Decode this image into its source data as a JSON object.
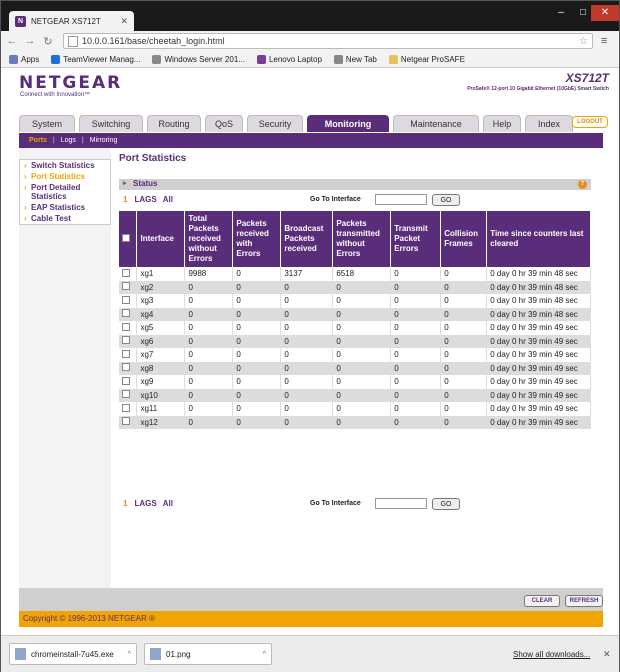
{
  "browser": {
    "tab_title": "NETGEAR XS712T",
    "favicon_letter": "N",
    "url": "10.0.0.161/base/cheetah_login.html",
    "bookmarks": [
      {
        "label": "Apps",
        "color": "#6b7bbf"
      },
      {
        "label": "TeamViewer Manag...",
        "color": "#1e6fd9"
      },
      {
        "label": "Windows Server 201...",
        "color": "#888888"
      },
      {
        "label": "Lenovo Laptop",
        "color": "#7a3b9a"
      },
      {
        "label": "New Tab",
        "color": "#888888"
      },
      {
        "label": "Netgear ProSAFE",
        "color": "#e8c060"
      }
    ]
  },
  "brand": {
    "logo": "NETGEAR",
    "tagline": "Connect with Innovation™",
    "model": "XS712T",
    "model_desc": "ProSafe® 12-port 10 Gigabit Ethernet (10GbE) Smart Switch"
  },
  "main_tabs": [
    {
      "label": "System",
      "active": false
    },
    {
      "label": "Switching",
      "active": false
    },
    {
      "label": "Routing",
      "active": false
    },
    {
      "label": "QoS",
      "active": false
    },
    {
      "label": "Security",
      "active": false
    },
    {
      "label": "Monitoring",
      "active": true
    },
    {
      "label": "Maintenance",
      "active": false
    },
    {
      "label": "Help",
      "active": false
    },
    {
      "label": "Index",
      "active": false
    }
  ],
  "logout_label": "LOGOUT",
  "sub_tabs": [
    {
      "label": "Ports",
      "active": true
    },
    {
      "label": "Logs",
      "active": false
    },
    {
      "label": "Mirroring",
      "active": false
    }
  ],
  "side_nav": [
    {
      "label": "Switch Statistics",
      "active": false
    },
    {
      "label": "Port Statistics",
      "active": true
    },
    {
      "label": "Port Detailed Statistics",
      "active": false
    },
    {
      "label": "EAP Statistics",
      "active": false
    },
    {
      "label": "Cable Test",
      "active": false
    }
  ],
  "page_title": "Port Statistics",
  "status_label": "Status",
  "help_glyph": "?",
  "filter": {
    "num": "1",
    "lags": "LAGS",
    "all": "All",
    "goto_label": "Go To Interface",
    "go_label": "GO"
  },
  "table": {
    "headers": [
      "",
      "Interface",
      "Total Packets received without Errors",
      "Packets received with Errors",
      "Broadcast Packets received",
      "Packets transmitted without Errors",
      "Transmit Packet Errors",
      "Collision Frames",
      "Time since counters last cleared"
    ],
    "rows": [
      [
        "xg1",
        "9988",
        "0",
        "3137",
        "6518",
        "0",
        "0",
        "0 day 0 hr 39 min 48 sec"
      ],
      [
        "xg2",
        "0",
        "0",
        "0",
        "0",
        "0",
        "0",
        "0 day 0 hr 39 min 48 sec"
      ],
      [
        "xg3",
        "0",
        "0",
        "0",
        "0",
        "0",
        "0",
        "0 day 0 hr 39 min 48 sec"
      ],
      [
        "xg4",
        "0",
        "0",
        "0",
        "0",
        "0",
        "0",
        "0 day 0 hr 39 min 48 sec"
      ],
      [
        "xg5",
        "0",
        "0",
        "0",
        "0",
        "0",
        "0",
        "0 day 0 hr 39 min 49 sec"
      ],
      [
        "xg6",
        "0",
        "0",
        "0",
        "0",
        "0",
        "0",
        "0 day 0 hr 39 min 49 sec"
      ],
      [
        "xg7",
        "0",
        "0",
        "0",
        "0",
        "0",
        "0",
        "0 day 0 hr 39 min 49 sec"
      ],
      [
        "xg8",
        "0",
        "0",
        "0",
        "0",
        "0",
        "0",
        "0 day 0 hr 39 min 49 sec"
      ],
      [
        "xg9",
        "0",
        "0",
        "0",
        "0",
        "0",
        "0",
        "0 day 0 hr 39 min 49 sec"
      ],
      [
        "xg10",
        "0",
        "0",
        "0",
        "0",
        "0",
        "0",
        "0 day 0 hr 39 min 49 sec"
      ],
      [
        "xg11",
        "0",
        "0",
        "0",
        "0",
        "0",
        "0",
        "0 day 0 hr 39 min 49 sec"
      ],
      [
        "xg12",
        "0",
        "0",
        "0",
        "0",
        "0",
        "0",
        "0 day 0 hr 39 min 49 sec"
      ]
    ]
  },
  "buttons": {
    "clear": "CLEAR",
    "refresh": "REFRESH"
  },
  "copyright": "Copyright © 1996-2013 NETGEAR ®",
  "downloads": {
    "items": [
      {
        "label": "chromeinstall-7u45.exe"
      },
      {
        "label": "01.png"
      }
    ],
    "show_all": "Show all downloads..."
  },
  "colors": {
    "brand": "#5a2d7a",
    "accent": "#f0a500"
  }
}
